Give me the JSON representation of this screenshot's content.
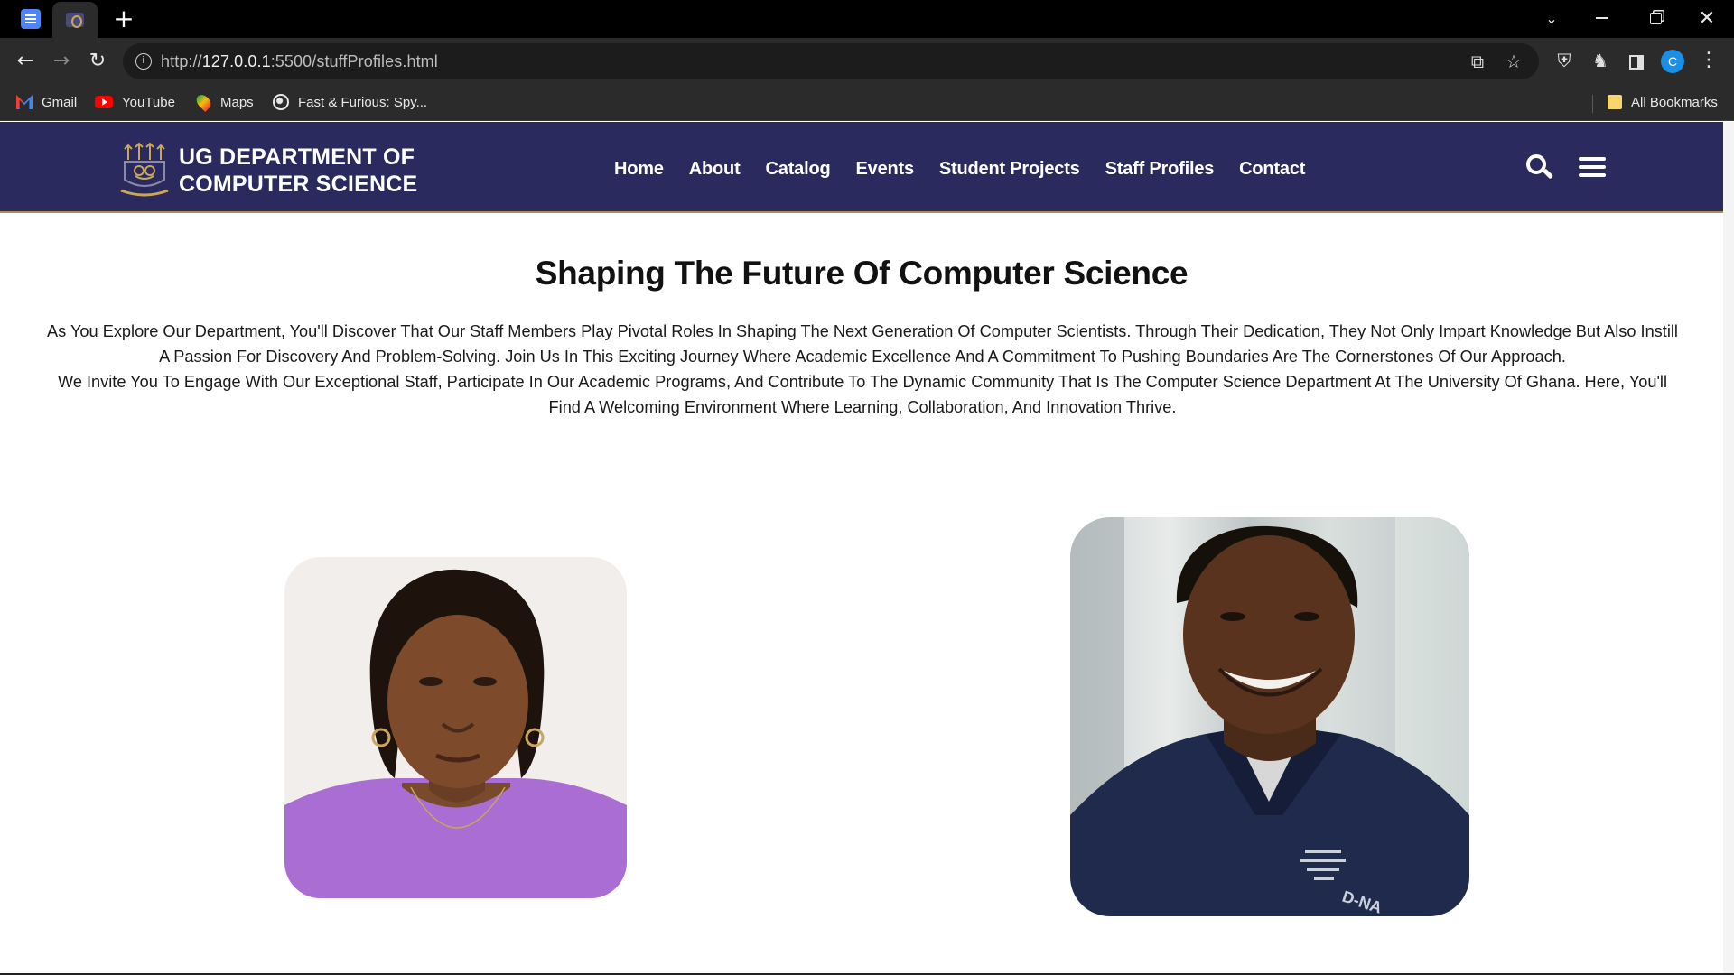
{
  "browser": {
    "new_tab_symbol": "+",
    "url_prefix": "http://",
    "url_host": "127.0.0.1",
    "url_rest": ":5500/stuffProfiles.html",
    "avatar_letter": "C",
    "bookmarks": [
      {
        "label": "Gmail",
        "icon": "gmail-icon"
      },
      {
        "label": "YouTube",
        "icon": "youtube-icon"
      },
      {
        "label": "Maps",
        "icon": "maps-icon"
      },
      {
        "label": "Fast & Furious: Spy...",
        "icon": "globe-icon"
      }
    ],
    "all_bookmarks_label": "All Bookmarks"
  },
  "header": {
    "brand_line1": "UG DEPARTMENT OF",
    "brand_line2": "COMPUTER SCIENCE",
    "nav": [
      "Home",
      "About",
      "Catalog",
      "Events",
      "Student Projects",
      "Staff Profiles",
      "Contact"
    ],
    "background_color": "#2b2a5e",
    "accent_color": "#b58a57"
  },
  "main": {
    "title": "Shaping The Future Of Computer Science",
    "intro_paragraph_1": "As You Explore Our Department, You'll Discover That Our Staff Members Play Pivotal Roles In Shaping The Next Generation Of Computer Scientists. Through Their Dedication, They Not Only Impart Knowledge But Also Instill A Passion For Discovery And Problem-Solving. Join Us In This Exciting Journey Where Academic Excellence And A Commitment To Pushing Boundaries Are The Cornerstones Of Our Approach.",
    "intro_paragraph_2": "We Invite You To Engage With Our Exceptional Staff, Participate In Our Academic Programs, And Contribute To The Dynamic Community That Is The Computer Science Department At The University Of Ghana. Here, You'll Find A Welcoming Environment Where Learning, Collaboration, And Innovation Thrive.",
    "shirt_logo_text": "D-NA"
  }
}
